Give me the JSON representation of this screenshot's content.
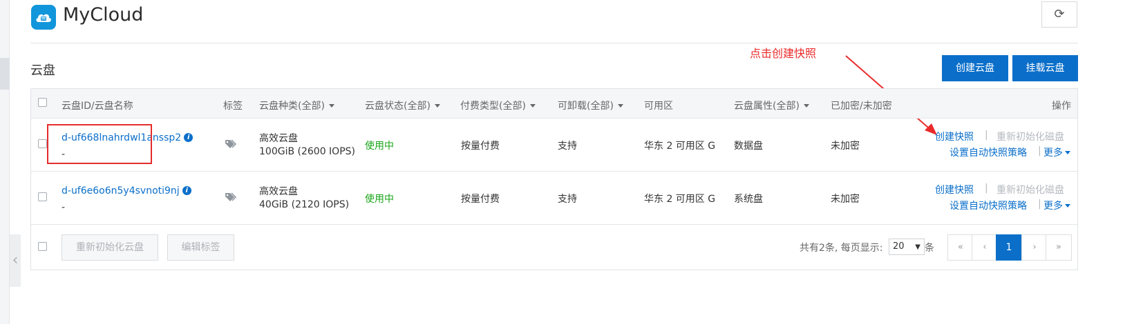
{
  "app": {
    "title": "MyCloud",
    "icon": "cloud-server-icon"
  },
  "toolbar": {
    "refresh_icon": "refresh-icon"
  },
  "section": {
    "title": "云盘"
  },
  "actions": {
    "create": "创建云盘",
    "mount": "挂载云盘"
  },
  "annotation": {
    "text": "点击创建快照",
    "color": "#ea2a2a"
  },
  "table": {
    "headers": {
      "id_name": "云盘ID/云盘名称",
      "tags": "标签",
      "type": "云盘种类(全部)",
      "status": "云盘状态(全部)",
      "billing": "付费类型(全部)",
      "detachable": "可卸载(全部)",
      "zone": "可用区",
      "attribute": "云盘属性(全部)",
      "encrypted": "已加密/未加密",
      "ops": "操作"
    },
    "rows": [
      {
        "id": "d-uf668lnahrdwl1anssp2",
        "name": "-",
        "type": "高效云盘",
        "capacity": "100GiB (2600 IOPS)",
        "status": "使用中",
        "billing": "按量付费",
        "detachable": "支持",
        "zone": "华东 2 可用区 G",
        "attribute": "数据盘",
        "encrypted": "未加密",
        "op_snapshot": "创建快照",
        "op_sep1": "|",
        "op_reinit": "重新初始化磁盘",
        "op_policy": "设置自动快照策略",
        "op_sep2": "|",
        "op_more": "更多"
      },
      {
        "id": "d-uf6e6o6n5y4svnoti9nj",
        "name": "-",
        "type": "高效云盘",
        "capacity": "40GiB (2120 IOPS)",
        "status": "使用中",
        "billing": "按量付费",
        "detachable": "支持",
        "zone": "华东 2 可用区 G",
        "attribute": "系统盘",
        "encrypted": "未加密",
        "op_snapshot": "创建快照",
        "op_sep1": "|",
        "op_reinit": "重新初始化磁盘",
        "op_policy": "设置自动快照策略",
        "op_sep2": "|",
        "op_more": "更多"
      }
    ]
  },
  "footer": {
    "reinit_button": "重新初始化云盘",
    "edit_tags_button": "编辑标签",
    "total_text": "共有2条, 每页显示:",
    "page_size": "20",
    "unit": "条",
    "pager": {
      "first": "«",
      "prev": "‹",
      "current": "1",
      "next": "›",
      "last": "»"
    }
  },
  "colors": {
    "primary": "#0b6fca",
    "status_ok": "#17a417",
    "annotation": "#ea2a2a"
  }
}
